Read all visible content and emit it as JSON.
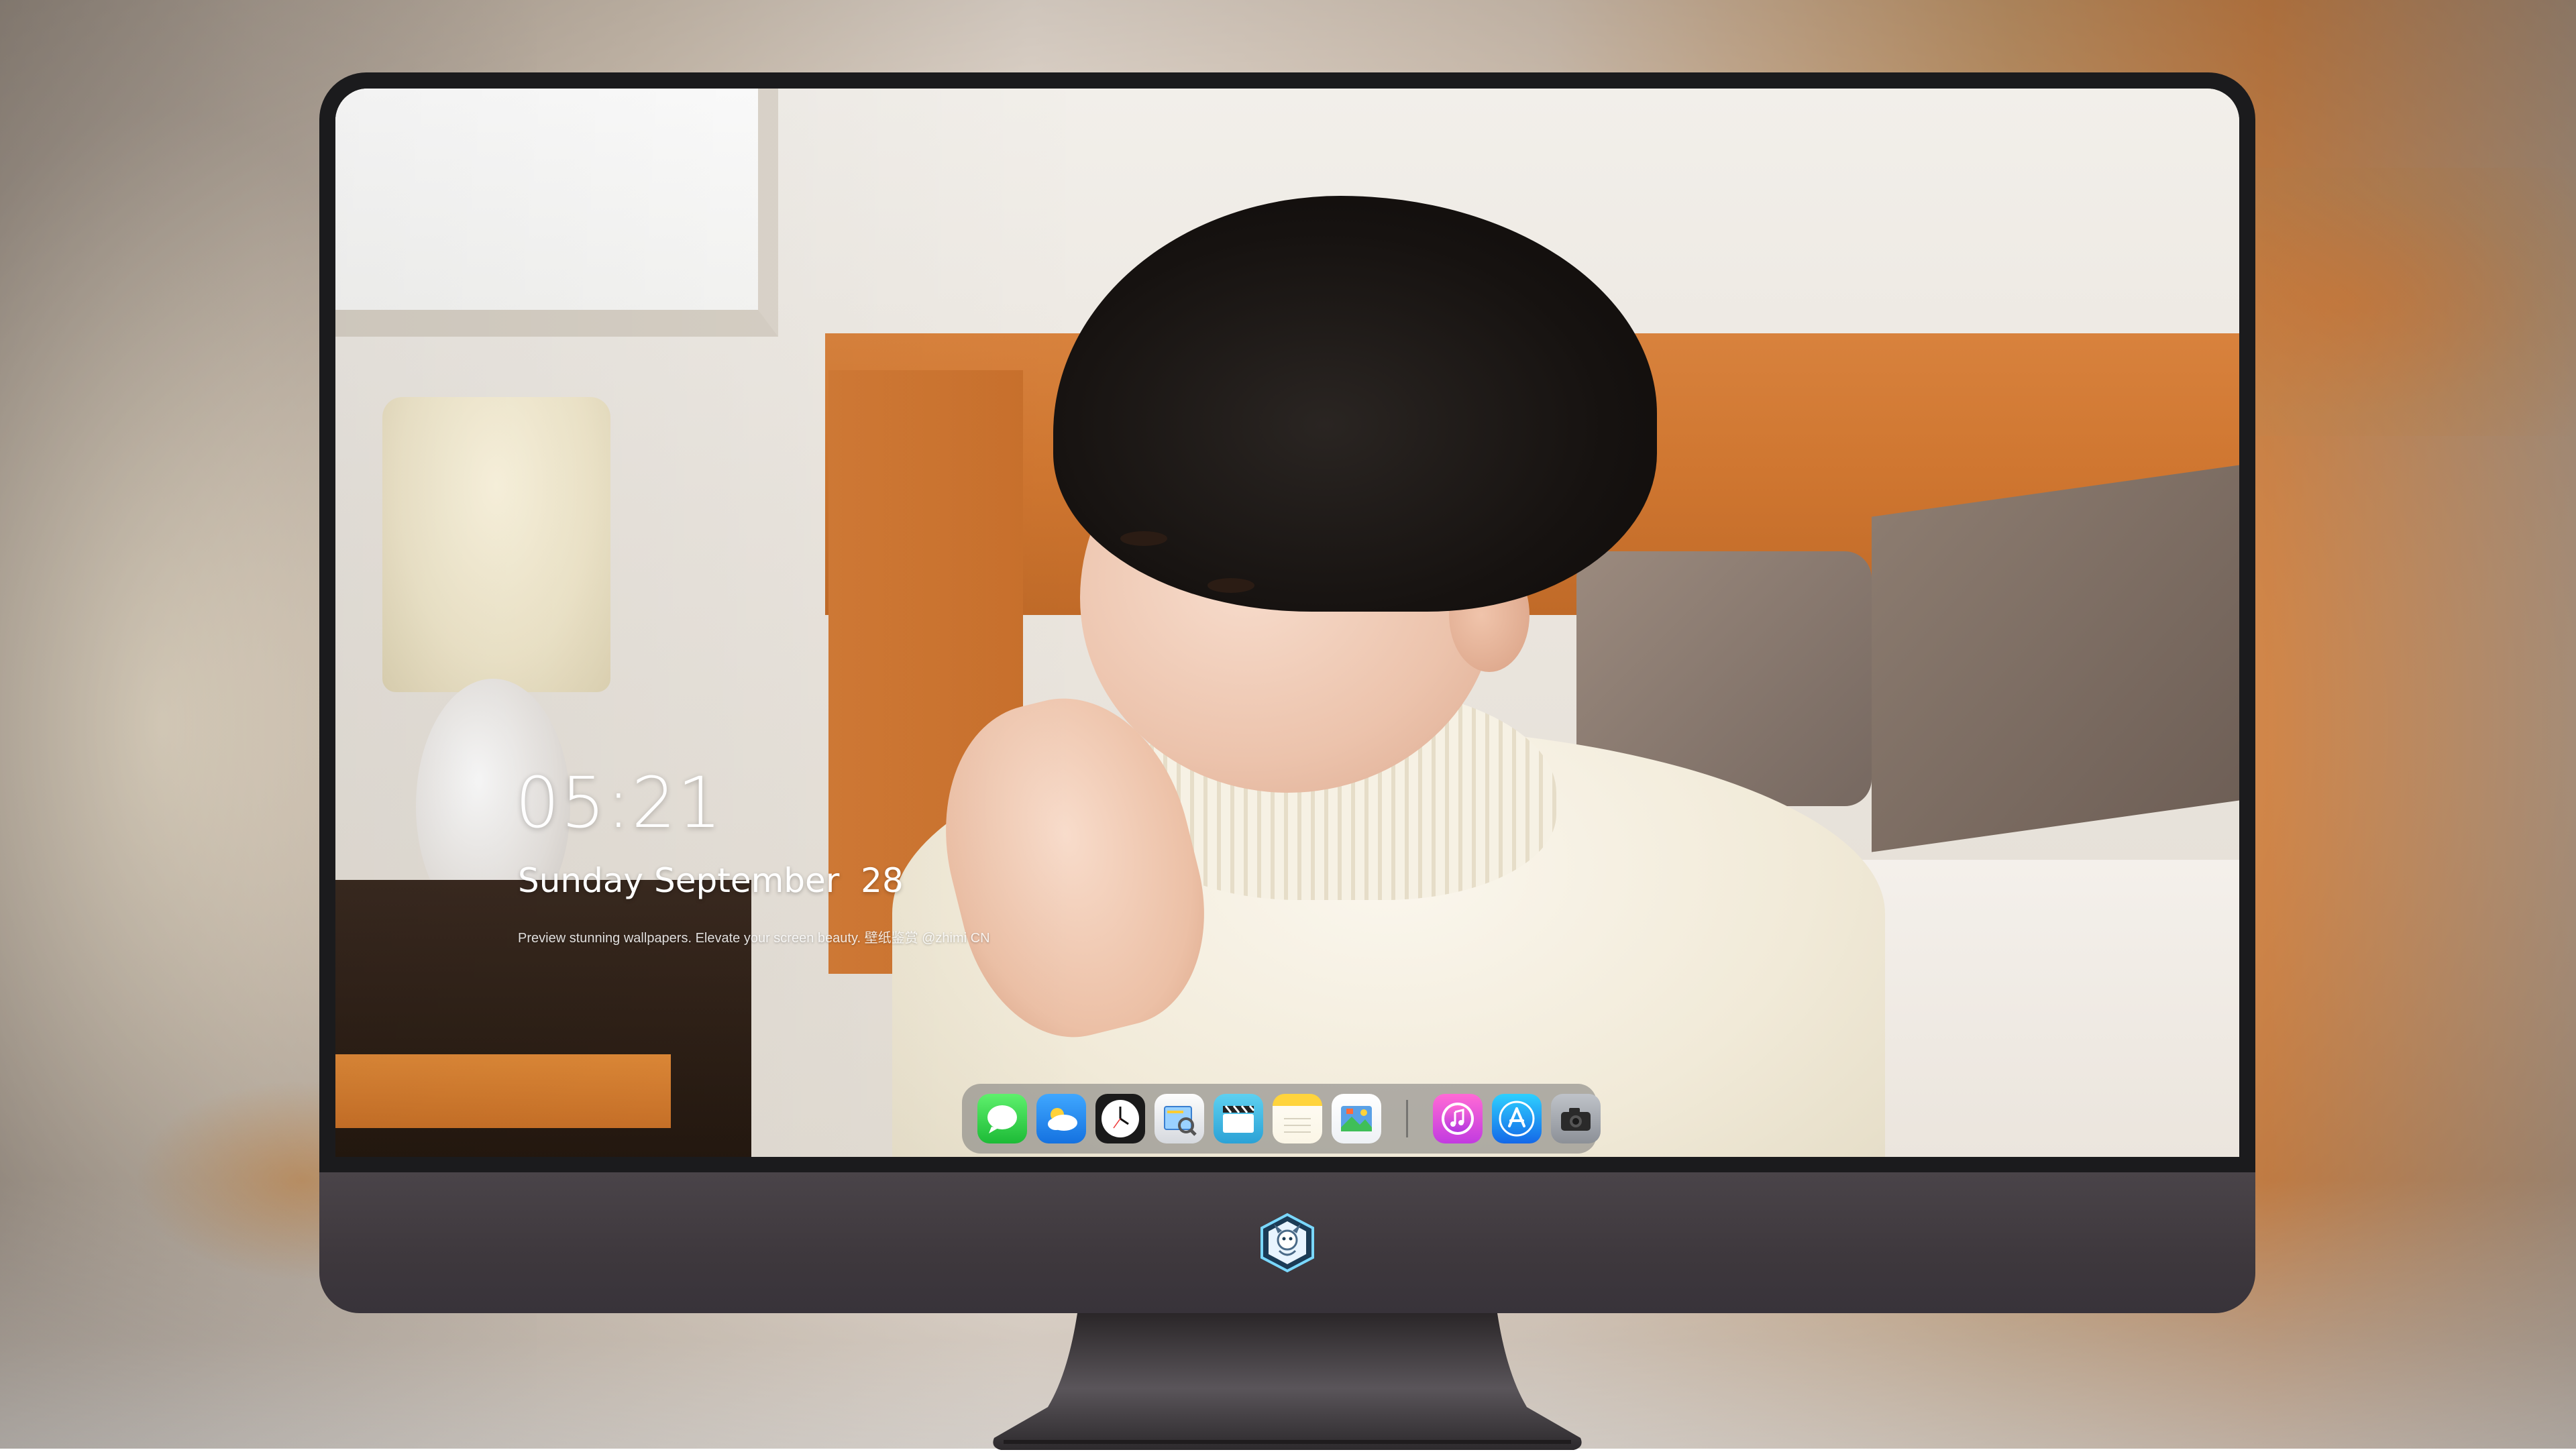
{
  "lockscreen": {
    "time": "05:21",
    "date": "Sunday September  28",
    "tagline": "Preview stunning wallpapers. Elevate your screen beauty. 壁纸鉴赏  @zhimi CN"
  },
  "dock": {
    "apps": [
      {
        "name": "Messages",
        "icon": "messages-icon"
      },
      {
        "name": "Weather",
        "icon": "weather-icon"
      },
      {
        "name": "Clock",
        "icon": "clock-icon"
      },
      {
        "name": "Preview",
        "icon": "preview-icon"
      },
      {
        "name": "Clips",
        "icon": "clapperboard-icon"
      },
      {
        "name": "Notes",
        "icon": "notes-icon"
      },
      {
        "name": "Photos",
        "icon": "photos-icon"
      },
      {
        "name": "Music",
        "icon": "music-note-icon"
      },
      {
        "name": "App Store",
        "icon": "app-store-icon"
      },
      {
        "name": "Camera",
        "icon": "camera-icon"
      }
    ]
  },
  "colors": {
    "monitor_bezel": "#1b1b1d",
    "monitor_chin": "#423c41",
    "headboard": "#d17a36",
    "dock_bg": "rgba(120,120,120,0.55)"
  }
}
